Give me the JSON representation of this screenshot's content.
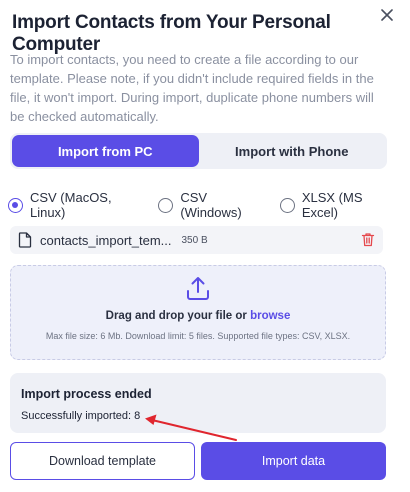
{
  "dialog": {
    "title": "Import Contacts from Your Personal Computer",
    "description": "To import contacts, you need to create a file according to our template. Please note, if you didn't include required fields in the file, it won't import. During import, duplicate phone numbers will be checked automatically."
  },
  "tabs": [
    {
      "label": "Import from PC",
      "active": true
    },
    {
      "label": "Import with Phone",
      "active": false
    }
  ],
  "formats": [
    {
      "label": "CSV (MacOS, Linux)",
      "checked": true
    },
    {
      "label": "CSV (Windows)",
      "checked": false
    },
    {
      "label": "XLSX (MS Excel)",
      "checked": false
    }
  ],
  "file": {
    "name": "contacts_import_tem...",
    "size": "350 B"
  },
  "dropzone": {
    "text": "Drag and drop your file or",
    "link": "browse",
    "hint": "Max file size: 6 Mb. Download limit: 5 files. Supported file types: CSV, XLSX."
  },
  "status": {
    "title": "Import process ended",
    "result": "Successfully imported: 8"
  },
  "actions": {
    "download_label": "Download template",
    "import_label": "Import data"
  },
  "colors": {
    "accent": "#5a4de6",
    "annotation_arrow": "#e0262e",
    "delete_icon": "#e5484d"
  }
}
